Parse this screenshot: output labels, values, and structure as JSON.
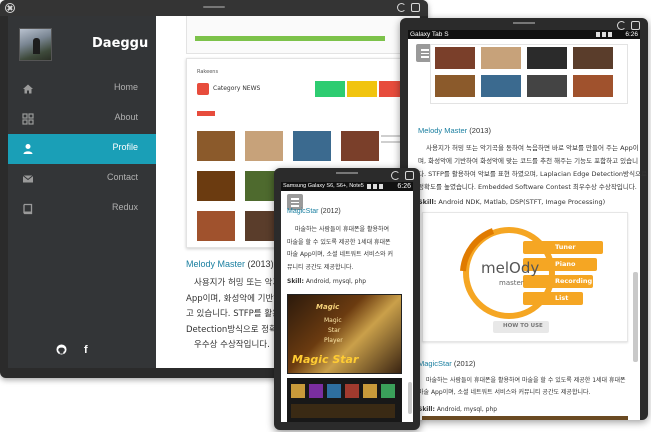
{
  "back_window": {
    "brand": "Daeggu",
    "nav": [
      {
        "label": "Home",
        "icon": "home-icon",
        "active": false
      },
      {
        "label": "About",
        "icon": "grid-icon",
        "active": false
      },
      {
        "label": "Profile",
        "icon": "user-icon",
        "active": true
      },
      {
        "label": "Contact",
        "icon": "envelope-icon",
        "active": false
      },
      {
        "label": "Redux",
        "icon": "book-icon",
        "active": false
      }
    ],
    "social": {
      "github_glyph": "●",
      "facebook_glyph": "f"
    },
    "shot": {
      "logo_text": "Rakeens",
      "category_label": "Category NEWS"
    },
    "melody": {
      "title": "Melody Master",
      "year": "(2013)",
      "lines": [
        "사용지가 허밍 또는 악기",
        "App이며, 화성악에 기반해",
        "고 있습니다. STFP를 활용",
        "Detection방식으로 정확도",
        "우수상 수상작입니다."
      ]
    },
    "accent_color": "#1a9fb7"
  },
  "tablet_window": {
    "device_name": "Galaxy Tab S",
    "time": "6:26",
    "melody": {
      "title": "Melody Master",
      "year": "(2013)",
      "lines": [
        "사용지가 허밍 또는 악기곡을 동하여 녹음하면 바로 악보를 만들어 주는 App이",
        "며, 화성악에 기반하여 화성악에 맞는 코드를 추천 해주는 기능도 포함하고 있습니",
        "다. STFP를 활용하여 악보를 표현 하였으며, Laplacian Edge Detection방식으로",
        "정확도를 높였습니다. Embedded Software Contest 최우수상 수상작입니다."
      ],
      "skill_label": "Skill:",
      "skill_value": "Android NDK, Matlab, DSP(STFT, Image Processing)"
    },
    "logo": {
      "word": "melOdy",
      "sub": "master",
      "menu": [
        "Tuner",
        "Piano",
        "Recording",
        "List"
      ],
      "how_to_use": "HOW TO USE"
    },
    "magicstar": {
      "title": "MagicStar",
      "year": "(2012)",
      "lines": [
        "마술하는 사람들이 휴대폰을 활용하여 마술을 할 수 있도록 제공한 1세대 휴대폰",
        "마술 App이며, 소셜 네트워트 서비스와 커뮤니티 공간도 제공합니다."
      ],
      "skill_label": "Skill:",
      "skill_value": "Android, mysql, php"
    }
  },
  "phone_window": {
    "device_name": "Samsung Galaxy S6, S6+, Note5",
    "time": "6:26",
    "magicstar": {
      "title": "MagicStar",
      "year": "(2012)",
      "lines": [
        "마술하는 사람들이 휴대폰을 활용하여",
        "마술을 할 수 있도록 제공한 1세대 휴대폰",
        "마술 App이며, 소셜 네트워트 서비스와 커",
        "뮤니티 공간도 제공합니다."
      ],
      "skill_label": "Skill:",
      "skill_value": "Android, mysql, php"
    },
    "image_words": [
      "Magic",
      "Magic",
      "Star",
      "Player",
      "Magic Star"
    ]
  }
}
